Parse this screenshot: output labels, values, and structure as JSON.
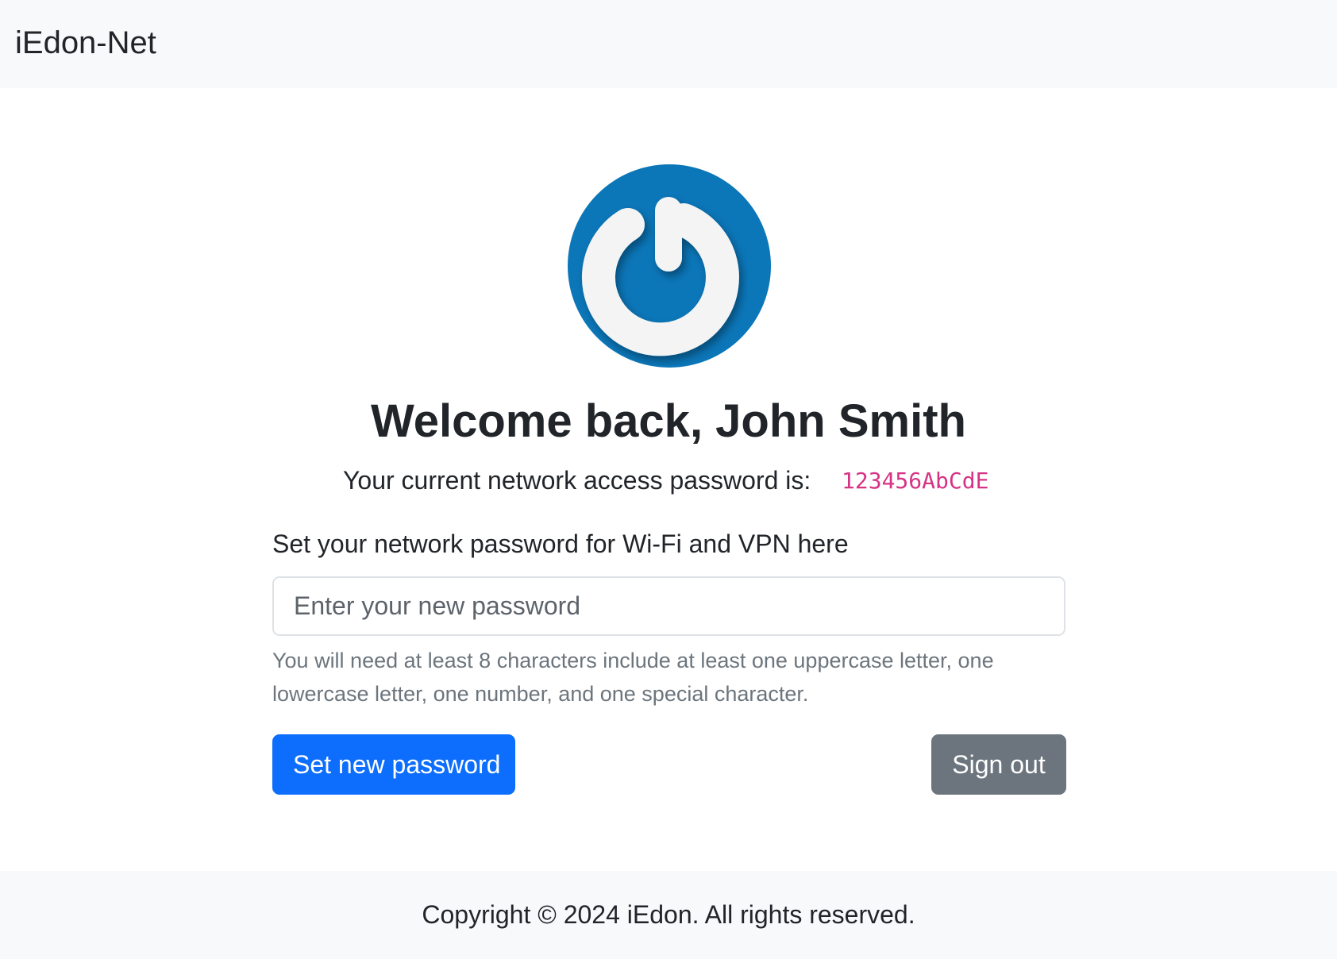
{
  "navbar": {
    "brand": "iEdon-Net"
  },
  "logo": {
    "icon": "power-icon",
    "color": "#0b76b8"
  },
  "main": {
    "welcome": "Welcome back, John Smith",
    "current_password_label": "Your current network access password is:",
    "current_password_value": "123456AbCdE",
    "form_label": "Set your network password for Wi-Fi and VPN here",
    "input_placeholder": "Enter your new password",
    "help_text": "You will need at least 8 characters include at least one uppercase letter, one lowercase letter, one number, and one special character.",
    "set_button": "Set new password",
    "signout_button": "Sign out"
  },
  "footer": {
    "copyright": "Copyright © 2024 iEdon. All rights reserved."
  },
  "colors": {
    "primary": "#0d6efd",
    "secondary": "#6c757d",
    "code": "#d63384",
    "light_bg": "#f8f9fa"
  }
}
